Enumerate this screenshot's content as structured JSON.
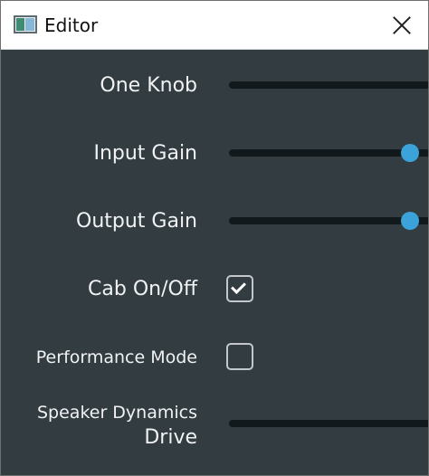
{
  "window": {
    "title": "Editor"
  },
  "controls": {
    "one_knob": {
      "label": "One Knob",
      "value": 0.0
    },
    "input_gain": {
      "label": "Input Gain",
      "value": 0.9
    },
    "output_gain": {
      "label": "Output Gain",
      "value": 0.9
    },
    "cab": {
      "label": "Cab On/Off",
      "checked": true
    },
    "performance": {
      "label": "Performance Mode",
      "checked": false
    },
    "speaker_dynamics": {
      "label_line1": "Speaker Dynamics",
      "label_line2": "Drive",
      "value": 0.0
    }
  },
  "colors": {
    "background": "#323c41",
    "track": "#12191c",
    "accent": "#3ba3d9"
  }
}
